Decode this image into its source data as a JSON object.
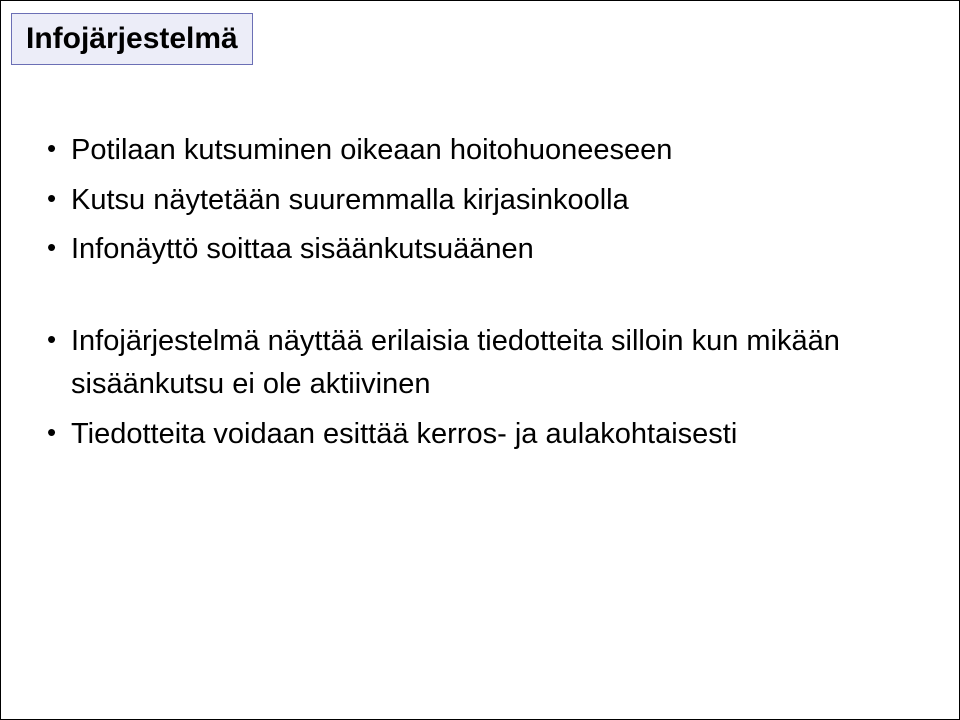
{
  "title": "Infojärjestelmä",
  "bullets_group1": [
    "Potilaan kutsuminen oikeaan hoitohuoneeseen",
    "Kutsu näytetään suuremmalla kirjasinkoolla",
    "Infonäyttö soittaa sisäänkutsuäänen"
  ],
  "bullets_group2": [
    "Infojärjestelmä näyttää erilaisia tiedotteita silloin kun mikään sisäänkutsu ei ole aktiivinen",
    "Tiedotteita voidaan esittää kerros- ja aulakohtaisesti"
  ]
}
